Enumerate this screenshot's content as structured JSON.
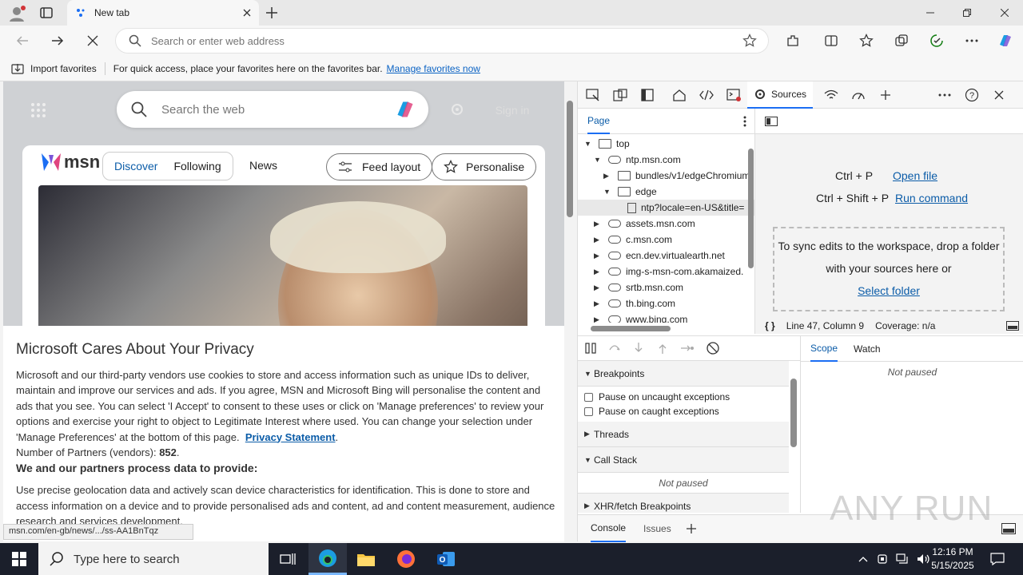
{
  "browser": {
    "tab_title": "New tab",
    "address_placeholder": "Search or enter web address",
    "favbar": {
      "import_label": "Import favorites",
      "message": "For quick access, place your favorites here on the favorites bar.",
      "manage_link": "Manage favorites now"
    }
  },
  "msn": {
    "search_placeholder": "Search the web",
    "signin": "Sign in",
    "logo_text": "msn",
    "tabs": [
      "Discover",
      "Following",
      "News"
    ],
    "feed_layout": "Feed layout",
    "personalise": "Personalise"
  },
  "privacy": {
    "title": "Microsoft Cares About Your Privacy",
    "body": "Microsoft and our third-party vendors use cookies to store and access information such as unique IDs to deliver, maintain and improve our services and ads. If you agree, MSN and Microsoft Bing will personalise the content and ads that you see. You can select 'I Accept' to consent to these uses or click on 'Manage preferences' to review your options and exercise your right to object to Legitimate Interest where used.  You can change your selection under 'Manage Preferences' at the bottom of this page.",
    "privacy_link": "Privacy Statement",
    "partners_label": "Number of Partners (vendors):",
    "partners_count": "852",
    "process_heading": "We and our partners process data to provide:",
    "process_text": "Use precise geolocation data and actively scan device characteristics for identification. This is done to store and access information on a device and to provide personalised ads and content, ad and content measurement, audience research and services development."
  },
  "status_url": "msn.com/en-gb/news/.../ss-AA1BnTqz",
  "devtools": {
    "active_tool": "Sources",
    "page_tab": "Page",
    "tree": [
      {
        "label": "top",
        "indent": 0,
        "arrow": "▼",
        "icon": "frame"
      },
      {
        "label": "ntp.msn.com",
        "indent": 1,
        "arrow": "▼",
        "icon": "cloud"
      },
      {
        "label": "bundles/v1/edgeChromium",
        "indent": 2,
        "arrow": "▶",
        "icon": "folder"
      },
      {
        "label": "edge",
        "indent": 2,
        "arrow": "▼",
        "icon": "folder"
      },
      {
        "label": "ntp?locale=en-US&title=",
        "indent": 3,
        "arrow": "",
        "icon": "file",
        "selected": true
      },
      {
        "label": "assets.msn.com",
        "indent": 1,
        "arrow": "▶",
        "icon": "cloud"
      },
      {
        "label": "c.msn.com",
        "indent": 1,
        "arrow": "▶",
        "icon": "cloud"
      },
      {
        "label": "ecn.dev.virtualearth.net",
        "indent": 1,
        "arrow": "▶",
        "icon": "cloud"
      },
      {
        "label": "img-s-msn-com.akamaized.",
        "indent": 1,
        "arrow": "▶",
        "icon": "cloud"
      },
      {
        "label": "srtb.msn.com",
        "indent": 1,
        "arrow": "▶",
        "icon": "cloud"
      },
      {
        "label": "th.bing.com",
        "indent": 1,
        "arrow": "▶",
        "icon": "cloud"
      },
      {
        "label": "www.bing.com",
        "indent": 1,
        "arrow": "▶",
        "icon": "cloud"
      }
    ],
    "shortcut1_keys": "Ctrl + P",
    "shortcut1_action": "Open file",
    "shortcut2_keys": "Ctrl + Shift + P",
    "shortcut2_action": "Run command",
    "drop_text": "To sync edits to the workspace, drop a folder with your sources here or",
    "select_folder": "Select folder",
    "status_pos": "Line 47, Column 9",
    "coverage": "Coverage: n/a",
    "scope_tab": "Scope",
    "watch_tab": "Watch",
    "not_paused": "Not paused",
    "breakpoints": "Breakpoints",
    "pause_uncaught": "Pause on uncaught exceptions",
    "pause_caught": "Pause on caught exceptions",
    "threads": "Threads",
    "call_stack": "Call Stack",
    "xhr": "XHR/fetch Breakpoints",
    "console_tab": "Console",
    "issues_tab": "Issues"
  },
  "taskbar": {
    "search_placeholder": "Type here to search",
    "time": "12:16 PM",
    "date": "5/15/2025"
  },
  "watermark": "ANY RUN"
}
